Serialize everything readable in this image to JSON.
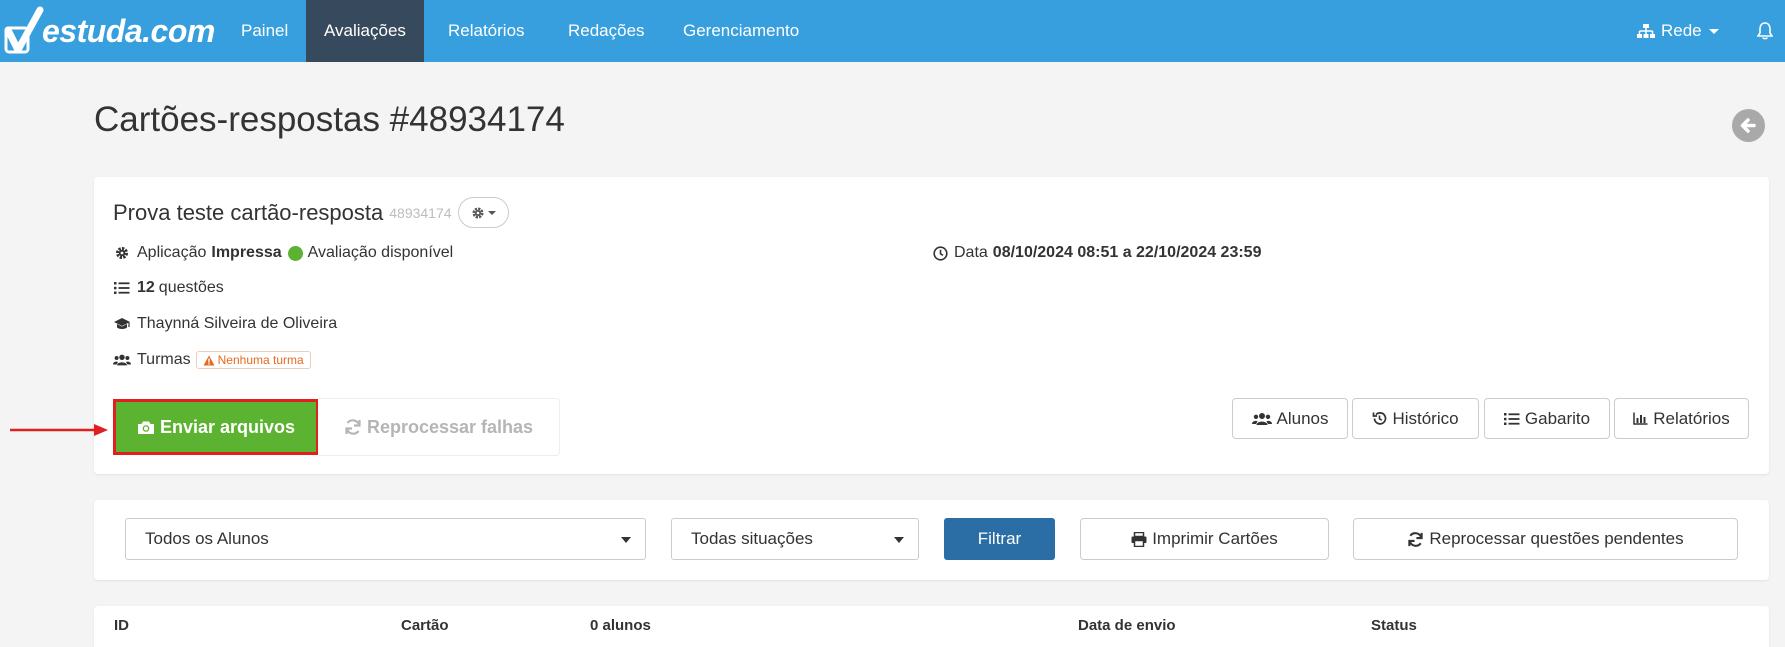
{
  "navbar": {
    "brand": "estuda.com",
    "items": [
      {
        "label": "Painel"
      },
      {
        "label": "Avaliações",
        "active": true
      },
      {
        "label": "Relatórios"
      },
      {
        "label": "Redações"
      },
      {
        "label": "Gerenciamento"
      }
    ],
    "network_label": "Rede",
    "colors": {
      "bar": "#379fdd",
      "active": "#37495c"
    }
  },
  "page": {
    "title": "Cartões-respostas #48934174"
  },
  "exam": {
    "title": "Prova teste cartão-resposta",
    "id": "48934174",
    "application_label": "Aplicação",
    "application_value": "Impressa",
    "availability": "Avaliação disponível",
    "date_label": "Data",
    "date_value": "08/10/2024 08:51 a 22/10/2024 23:59",
    "questions_count": "12",
    "questions_label": "questões",
    "teacher": "Thaynná Silveira de Oliveira",
    "classes_label": "Turmas",
    "classes_warning": "Nenhuma turma"
  },
  "actions": {
    "send_files": "Enviar arquivos",
    "reprocess_failures": "Reprocessar falhas",
    "students": "Alunos",
    "history": "Histórico",
    "answer_key": "Gabarito",
    "reports": "Relatórios"
  },
  "filters": {
    "students_select": "Todos os Alunos",
    "status_select": "Todas situações",
    "filter_button": "Filtrar",
    "print_cards": "Imprimir Cartões",
    "reprocess_pending": "Reprocessar questões pendentes"
  },
  "table": {
    "headers": [
      "ID",
      "Cartão",
      "0 alunos",
      "Data de envio",
      "Status"
    ]
  },
  "icons": {
    "gear": "gear-icon",
    "list": "list-icon",
    "graduation": "graduation-cap-icon",
    "users": "users-icon",
    "clock": "clock-icon",
    "camera": "camera-icon",
    "refresh": "refresh-icon",
    "history": "history-icon",
    "chart": "bar-chart-icon",
    "print": "print-icon",
    "warning": "warning-icon",
    "sitemap": "sitemap-icon",
    "bell": "bell-icon",
    "back": "arrow-left-circle-icon"
  }
}
